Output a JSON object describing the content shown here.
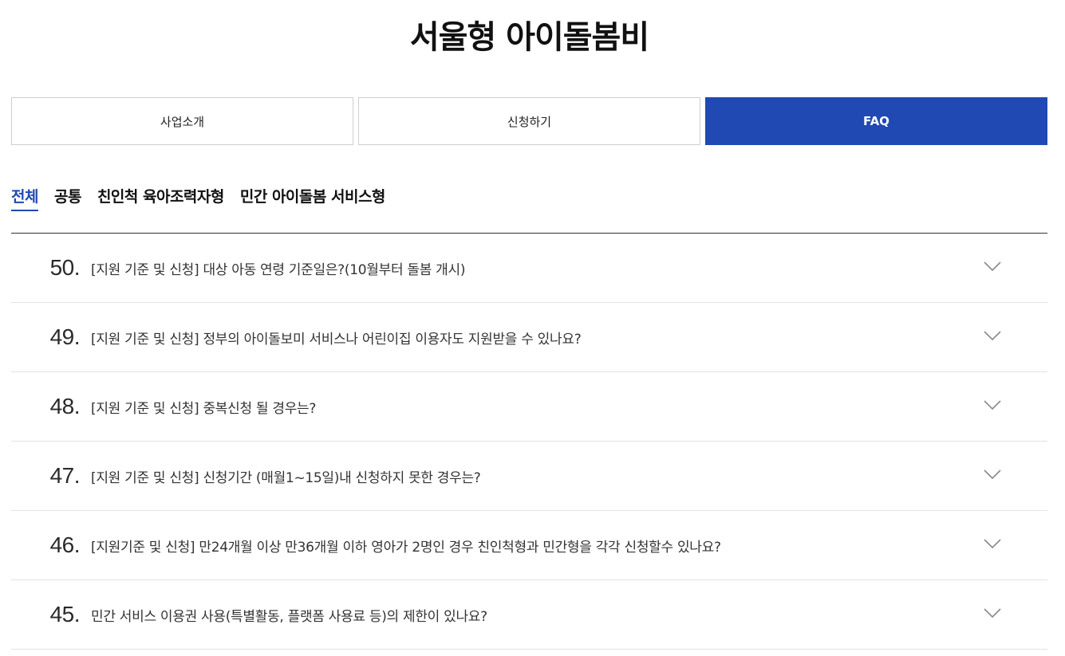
{
  "page": {
    "title": "서울형 아이돌봄비"
  },
  "tabs": [
    {
      "label": "사업소개"
    },
    {
      "label": "신청하기"
    },
    {
      "label": "FAQ"
    }
  ],
  "categories": [
    {
      "label": "전체"
    },
    {
      "label": "공통"
    },
    {
      "label": "친인척 육아조력자형"
    },
    {
      "label": "민간 아이돌봄 서비스형"
    }
  ],
  "faq": [
    {
      "number": "50.",
      "question": "[지원 기준 및 신청] 대상 아동 연령 기준일은?(10월부터 돌봄 개시)"
    },
    {
      "number": "49.",
      "question": "[지원 기준 및 신청] 정부의 아이돌보미 서비스나 어린이집 이용자도 지원받을 수 있나요?"
    },
    {
      "number": "48.",
      "question": "[지원 기준 및 신청] 중복신청 될 경우는?"
    },
    {
      "number": "47.",
      "question": "[지원 기준 및 신청] 신청기간 (매월1~15일)내 신청하지 못한 경우는?"
    },
    {
      "number": "46.",
      "question": "[지원기준 및 신청] 만24개월 이상 만36개월 이하 영아가 2명인 경우 친인척형과 민간형을 각각 신청할수 있나요?"
    },
    {
      "number": "45.",
      "question": "민간 서비스 이용권 사용(특별활동, 플랫폼 사용료 등)의 제한이 있나요?"
    }
  ],
  "colors": {
    "accent": "#2149b3"
  },
  "icons": {
    "expand": "chevron-down-icon"
  }
}
